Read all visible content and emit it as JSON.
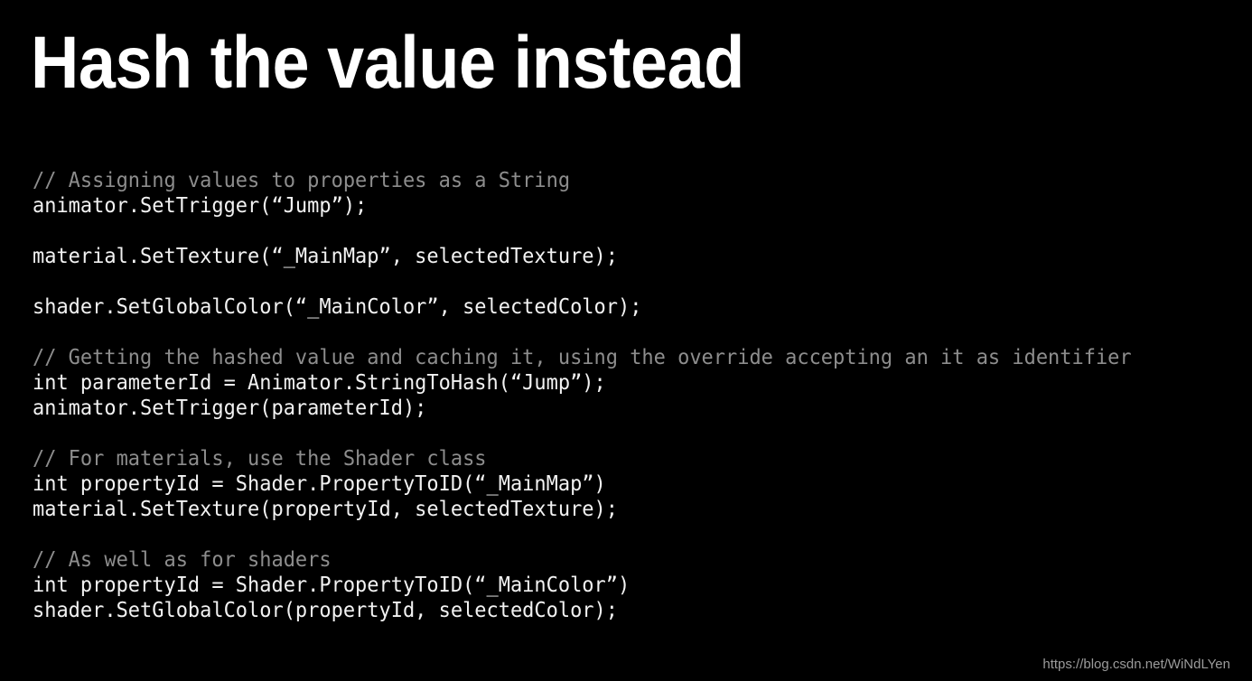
{
  "slide": {
    "background_color": "#000000",
    "title": "Hash the value instead",
    "title_color": "#ffffff",
    "code_color": "#f2f2f2",
    "comment_color": "#8d8d8d"
  },
  "code": {
    "lines": [
      {
        "text": "// Assigning values to properties as a String",
        "kind": "comment"
      },
      {
        "text": "animator.SetTrigger(“Jump”);",
        "kind": "code"
      },
      {
        "text": "",
        "kind": "blank"
      },
      {
        "text": "material.SetTexture(“_MainMap”, selectedTexture);",
        "kind": "code"
      },
      {
        "text": "",
        "kind": "blank"
      },
      {
        "text": "shader.SetGlobalColor(“_MainColor”, selectedColor);",
        "kind": "code"
      },
      {
        "text": "",
        "kind": "blank"
      },
      {
        "text": "// Getting the hashed value and caching it, using the override accepting an it as identifier",
        "kind": "comment"
      },
      {
        "text": "int parameterId = Animator.StringToHash(“Jump”);",
        "kind": "code"
      },
      {
        "text": "animator.SetTrigger(parameterId);",
        "kind": "code"
      },
      {
        "text": "",
        "kind": "blank"
      },
      {
        "text": "// For materials, use the Shader class",
        "kind": "comment"
      },
      {
        "text": "int propertyId = Shader.PropertyToID(“_MainMap”)",
        "kind": "code"
      },
      {
        "text": "material.SetTexture(propertyId, selectedTexture);",
        "kind": "code"
      },
      {
        "text": "",
        "kind": "blank"
      },
      {
        "text": "// As well as for shaders",
        "kind": "comment"
      },
      {
        "text": "int propertyId = Shader.PropertyToID(“_MainColor”)",
        "kind": "code"
      },
      {
        "text": "shader.SetGlobalColor(propertyId, selectedColor);",
        "kind": "code"
      }
    ]
  },
  "watermark": {
    "text": "https://blog.csdn.net/WiNdLYen"
  }
}
